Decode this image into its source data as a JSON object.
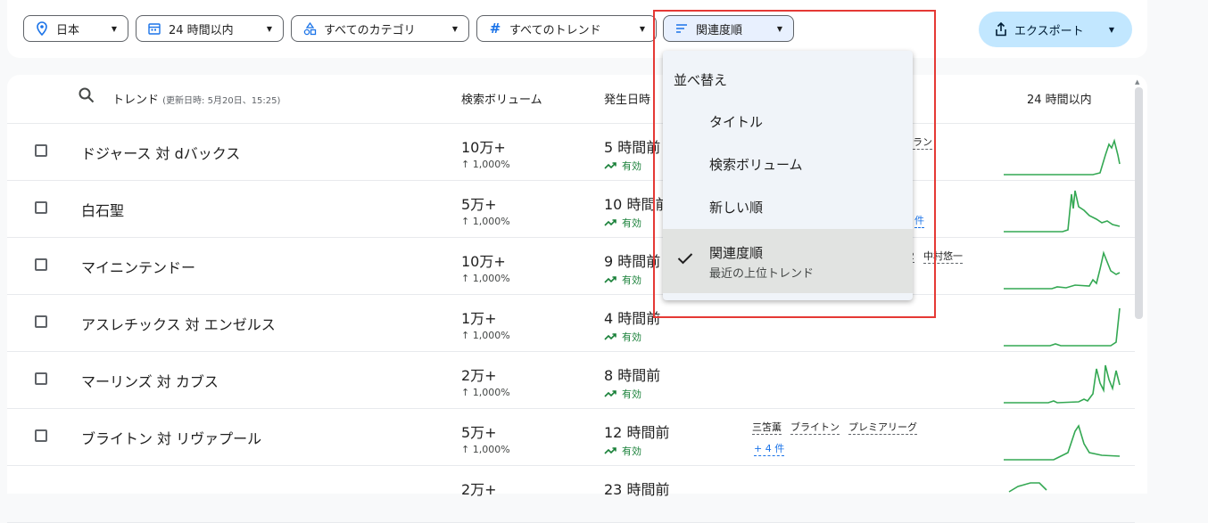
{
  "filters": {
    "location": "日本",
    "time": "24 時間以内",
    "category": "すべてのカテゴリ",
    "trend_type": "すべてのトレンド",
    "sort": "関連度順",
    "export": "エクスポート"
  },
  "table": {
    "col_trend": "トレンド",
    "col_updated": "(更新日時: 5月20日、15:25)",
    "col_volume": "検索ボリューム",
    "col_started": "発生日時",
    "col_chart": "24 時間以内",
    "rows": [
      {
        "title": "ドジャース 対 dバックス",
        "volume": "10万+",
        "change": "1,000%",
        "started": "5 時間前",
        "status": "有効",
        "tags": [
          "ラン"
        ],
        "more": ""
      },
      {
        "title": "白石聖",
        "volume": "5万+",
        "change": "1,000%",
        "started": "10 時間前",
        "status": "有効",
        "tags": [],
        "more": "件"
      },
      {
        "title": "マイニンテンドー",
        "volume": "10万+",
        "change": "1,000%",
        "started": "9 時間前",
        "status": "有効",
        "tags": [
          "2",
          "中村悠一"
        ],
        "more": ""
      },
      {
        "title": "アスレチックス 対 エンゼルス",
        "volume": "1万+",
        "change": "1,000%",
        "started": "4 時間前",
        "status": "有効",
        "tags": [],
        "more": ""
      },
      {
        "title": "マーリンズ 対 カブス",
        "volume": "2万+",
        "change": "1,000%",
        "started": "8 時間前",
        "status": "有効",
        "tags": [],
        "more": ""
      },
      {
        "title": "ブライトン 対 リヴァプール",
        "volume": "5万+",
        "change": "1,000%",
        "started": "12 時間前",
        "status": "有効",
        "tags": [
          "三笘薫",
          "ブライトン",
          "プレミアリーグ"
        ],
        "more": "+ 4 件"
      },
      {
        "title": "",
        "volume": "2万+",
        "change": "",
        "started": "23 時間前",
        "status": "",
        "tags": [],
        "more": ""
      }
    ]
  },
  "sort_menu": {
    "heading": "並べ替え",
    "items": [
      "タイトル",
      "検索ボリューム",
      "新しい順"
    ],
    "selected_label": "関連度順",
    "selected_desc": "最近の上位トレンド"
  },
  "colors": {
    "accent": "#1a73e8",
    "trend_green": "#34a853",
    "highlight": "#e53935"
  }
}
